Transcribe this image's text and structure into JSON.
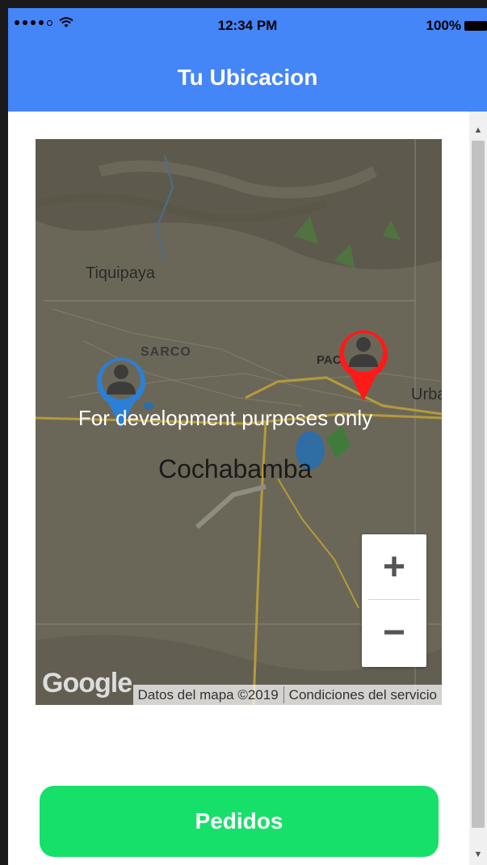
{
  "status_bar": {
    "time": "12:34 PM",
    "battery": "100%",
    "signal_icon": "signal-dots-icon",
    "wifi_icon": "wifi-icon",
    "battery_icon": "battery-icon"
  },
  "nav": {
    "title": "Tu Ubicacion",
    "background": "#4485f8"
  },
  "map": {
    "labels": {
      "tiquipaya": "Tiquipaya",
      "sarco": "SARCO",
      "pac": "PAC",
      "urba": "Urba",
      "city": "Cochabamba"
    },
    "watermark": "For development purposes only",
    "markers": [
      {
        "name": "user-location-marker",
        "color": "#2c7fd6",
        "icon": "person-icon"
      },
      {
        "name": "driver-location-marker",
        "color": "#ff1a1a",
        "icon": "person-icon"
      }
    ],
    "zoom_in": "+",
    "zoom_out": "−",
    "logo": "Google",
    "attribution_data": "Datos del mapa ©2019",
    "attribution_terms": "Condiciones del servicio"
  },
  "actions": {
    "pedidos_label": "Pedidos",
    "pedidos_color": "#16e06a"
  }
}
